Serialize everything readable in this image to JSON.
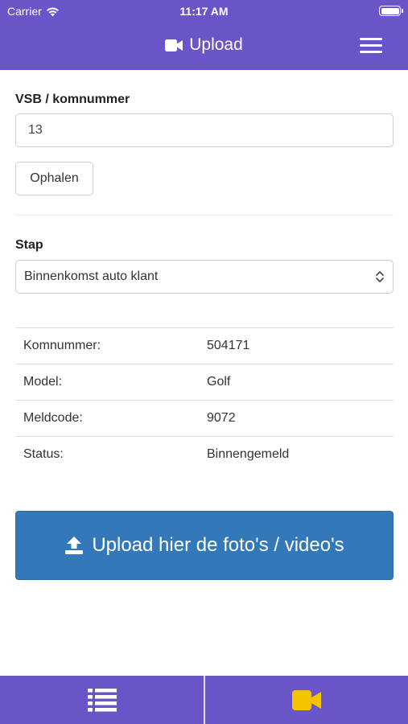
{
  "status_bar": {
    "carrier": "Carrier",
    "time": "11:17 AM"
  },
  "header": {
    "title": "Upload",
    "title_icon": "video-camera-icon",
    "menu_icon": "hamburger-menu-icon",
    "background": "#6a55c8"
  },
  "form": {
    "vsb_label": "VSB / komnummer",
    "vsb_value": "13",
    "fetch_button": "Ophalen",
    "stap_label": "Stap",
    "stap_selected": "Binnenkomst auto klant"
  },
  "details": [
    {
      "key": "Komnummer:",
      "value": "504171"
    },
    {
      "key": "Model:",
      "value": "Golf"
    },
    {
      "key": "Meldcode:",
      "value": "9072"
    },
    {
      "key": "Status:",
      "value": "Binnengemeld"
    }
  ],
  "upload": {
    "label": "Upload hier de foto's / video's",
    "icon": "upload-icon",
    "color": "#3379ba"
  },
  "tabbar": {
    "left_icon": "list-icon",
    "right_icon": "video-camera-icon",
    "active_color": "#f5c400"
  }
}
